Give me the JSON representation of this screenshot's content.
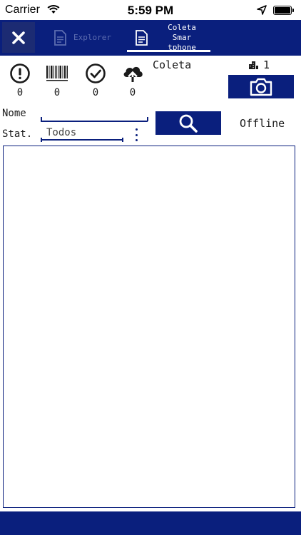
{
  "status_bar": {
    "carrier": "Carrier",
    "time": "5:59 PM"
  },
  "tabs": [
    {
      "label": "Explorer",
      "active": false
    },
    {
      "label": "Coleta Smar\ntphone",
      "active": true
    }
  ],
  "stats": [
    {
      "icon": "alert-icon",
      "value": "0"
    },
    {
      "icon": "barcode-icon",
      "value": "0"
    },
    {
      "icon": "check-icon",
      "value": "0"
    },
    {
      "icon": "cloud-upload-icon",
      "value": "0"
    }
  ],
  "coleta": {
    "label": "Coleta",
    "count": "1"
  },
  "filters": {
    "nome_label": "Nome",
    "nome_value": "",
    "stat_label": "Stat.",
    "stat_value": "Todos"
  },
  "connection_status": "Offline",
  "colors": {
    "primary": "#0a1f7d",
    "close_button_bg": "#1c2b73",
    "inactive_tab": "#5d6db0"
  }
}
